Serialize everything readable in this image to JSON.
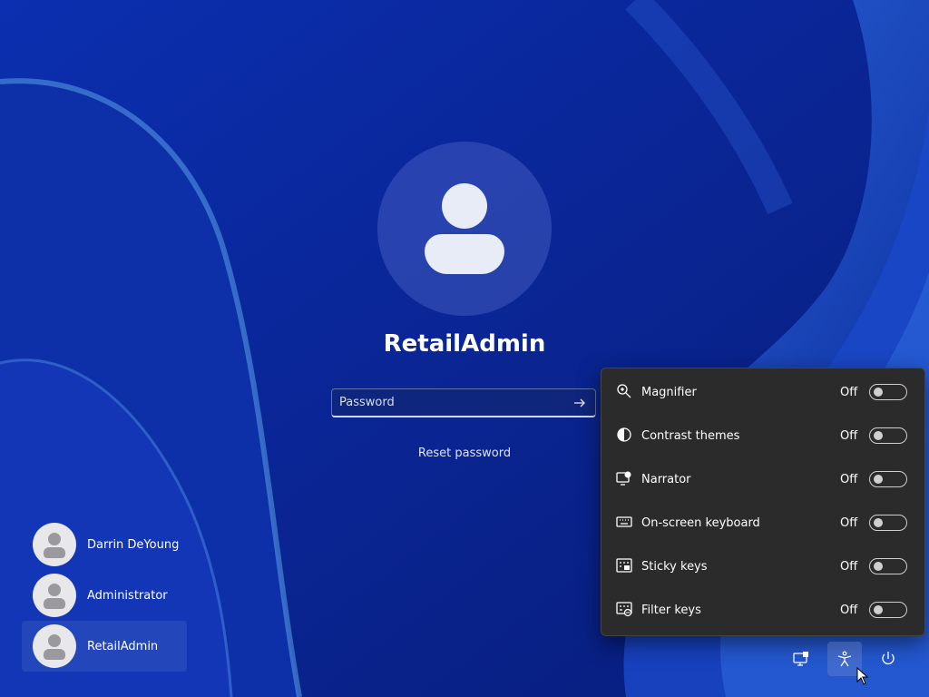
{
  "login": {
    "username": "RetailAdmin",
    "password_placeholder": "Password",
    "reset_password": "Reset password"
  },
  "users": [
    {
      "name": "Darrin DeYoung",
      "selected": false
    },
    {
      "name": "Administrator",
      "selected": false
    },
    {
      "name": "RetailAdmin",
      "selected": true
    }
  ],
  "accessibility": {
    "items": [
      {
        "label": "Magnifier",
        "state": "Off",
        "icon": "magnifier-icon"
      },
      {
        "label": "Contrast themes",
        "state": "Off",
        "icon": "contrast-icon"
      },
      {
        "label": "Narrator",
        "state": "Off",
        "icon": "narrator-icon"
      },
      {
        "label": "On-screen keyboard",
        "state": "Off",
        "icon": "keyboard-icon"
      },
      {
        "label": "Sticky keys",
        "state": "Off",
        "icon": "sticky-keys-icon"
      },
      {
        "label": "Filter keys",
        "state": "Off",
        "icon": "filter-keys-icon"
      }
    ]
  },
  "tray": {
    "buttons": [
      "network-icon",
      "accessibility-icon",
      "power-icon"
    ],
    "active": "accessibility-icon"
  },
  "colors": {
    "flyout_bg": "#2b2b2b",
    "wallpaper_dark": "#0a2a9c",
    "wallpaper_light": "#3a63d8"
  }
}
